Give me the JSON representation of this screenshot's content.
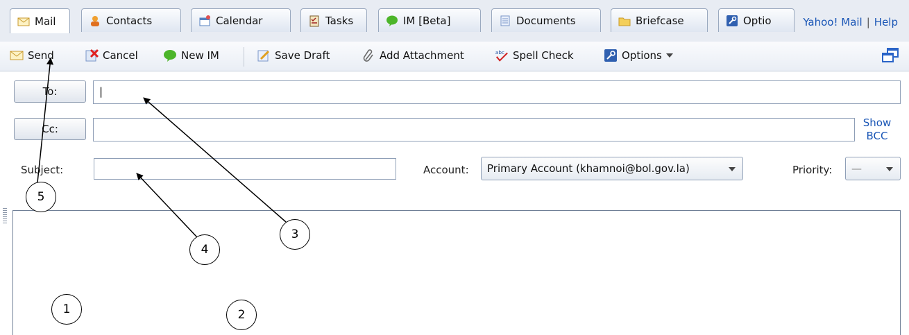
{
  "tabs": [
    {
      "label": "Mail",
      "icon": "envelope-icon",
      "active": true
    },
    {
      "label": "Contacts",
      "icon": "contacts-icon"
    },
    {
      "label": "Calendar",
      "icon": "calendar-icon"
    },
    {
      "label": "Tasks",
      "icon": "tasks-icon"
    },
    {
      "label": "IM [Beta]",
      "icon": "chat-bubble-icon"
    },
    {
      "label": "Documents",
      "icon": "documents-icon"
    },
    {
      "label": "Briefcase",
      "icon": "folder-icon"
    },
    {
      "label": "Optio",
      "icon": "options-icon"
    }
  ],
  "top_links": {
    "mail": "Yahoo! Mail",
    "separator": "|",
    "help": "Help"
  },
  "toolbar": {
    "send": "Send",
    "cancel": "Cancel",
    "new_im": "New IM",
    "save_draft": "Save Draft",
    "add_attachment": "Add Attachment",
    "spell_check": "Spell Check",
    "options": "Options"
  },
  "compose": {
    "to_label": "To:",
    "to_value": "|",
    "cc_label": "Cc:",
    "cc_value": "",
    "show_bcc_line1": "Show",
    "show_bcc_line2": "BCC",
    "subject_label": "Subject:",
    "subject_value": "",
    "account_label": "Account:",
    "account_value": "Primary Account (khamnoi@bol.gov.la)",
    "priority_label": "Priority:",
    "priority_value": "—"
  },
  "markers": [
    "1",
    "2",
    "3",
    "4",
    "5"
  ],
  "colors": {
    "link": "#1a56b6",
    "tabbar": "#e8ecf3",
    "annotation": "#000000"
  }
}
